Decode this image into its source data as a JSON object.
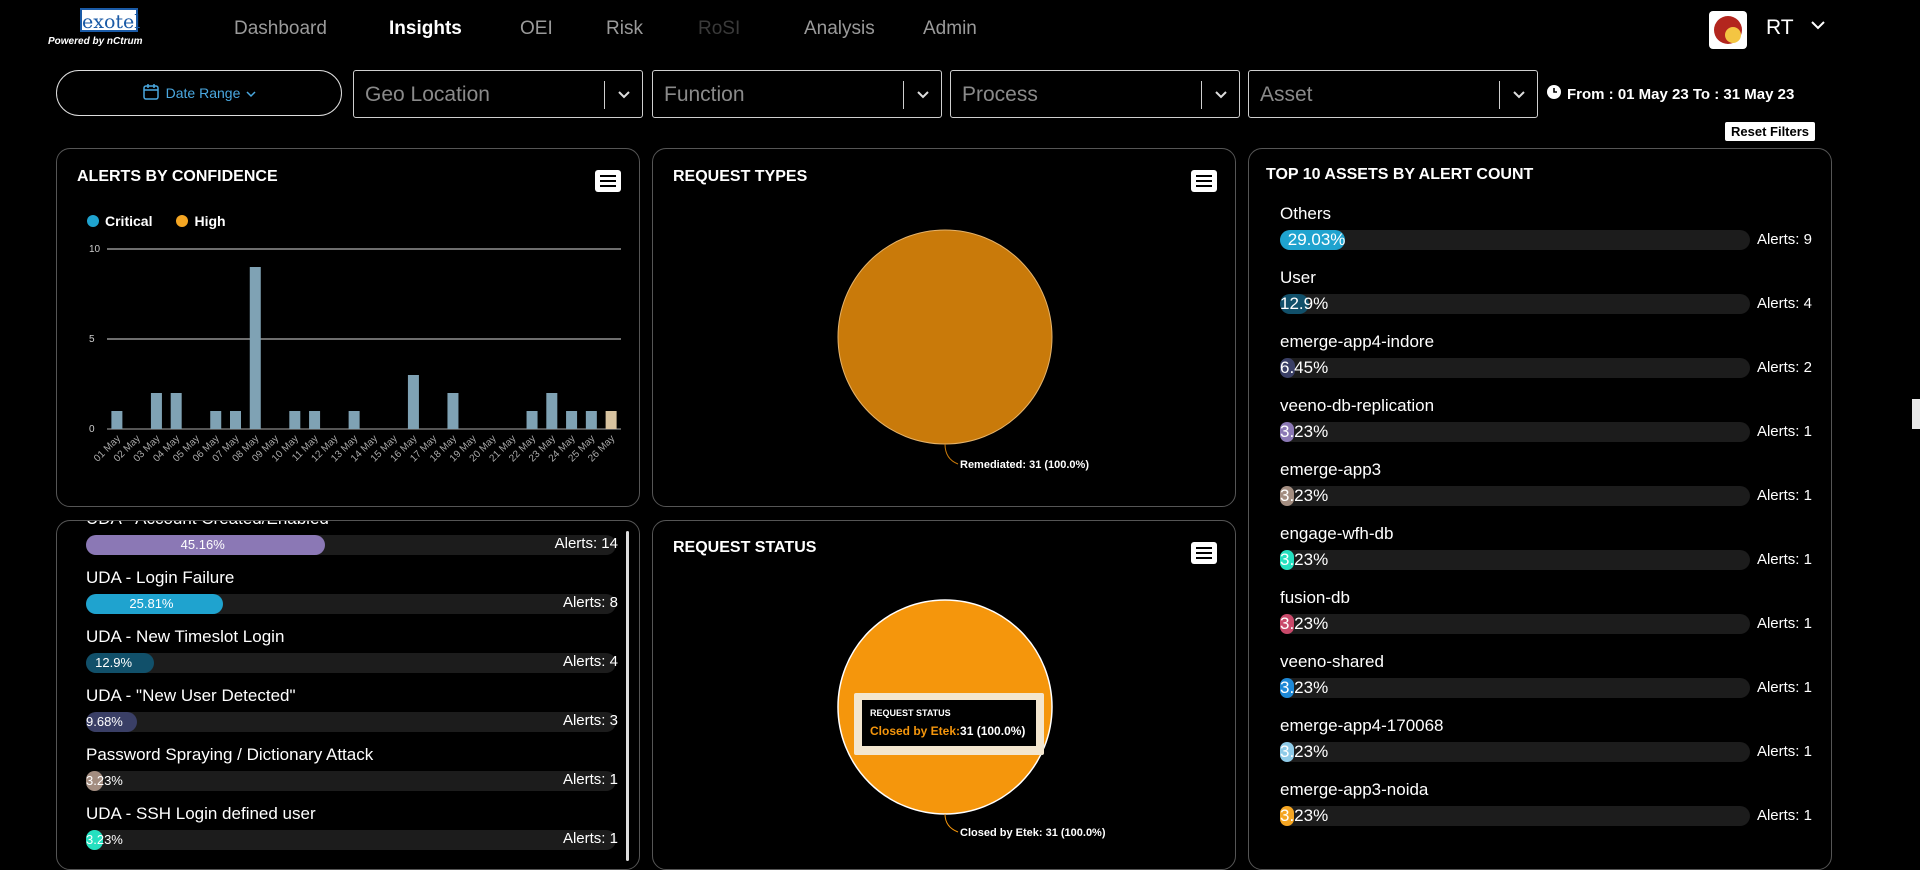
{
  "brand": {
    "name": "exotel",
    "powered_by": "Powered by nCtrum"
  },
  "nav": [
    {
      "label": "Dashboard",
      "state": "normal"
    },
    {
      "label": "Insights",
      "state": "active"
    },
    {
      "label": "OEI",
      "state": "normal"
    },
    {
      "label": "Risk",
      "state": "normal"
    },
    {
      "label": "RoSI",
      "state": "disabled"
    },
    {
      "label": "Analysis",
      "state": "normal"
    },
    {
      "label": "Admin",
      "state": "normal"
    }
  ],
  "user": {
    "initials": "RT"
  },
  "filters": {
    "date_range": "Date Range",
    "geo": "Geo Location",
    "function": "Function",
    "process": "Process",
    "asset": "Asset",
    "period": "From : 01 May 23 To : 31 May 23",
    "reset": "Reset Filters"
  },
  "alerts_by_confidence": {
    "title": "ALERTS BY CONFIDENCE",
    "legend": [
      {
        "label": "Critical",
        "color": "#1fa3cf"
      },
      {
        "label": "High",
        "color": "#f5a623"
      }
    ]
  },
  "chart_data": {
    "type": "bar",
    "title": "ALERTS BY CONFIDENCE",
    "categories": [
      "01 May",
      "02 May",
      "03 May",
      "04 May",
      "05 May",
      "06 May",
      "07 May",
      "08 May",
      "09 May",
      "10 May",
      "11 May",
      "12 May",
      "13 May",
      "14 May",
      "15 May",
      "16 May",
      "17 May",
      "18 May",
      "19 May",
      "20 May",
      "21 May",
      "22 May",
      "23 May",
      "24 May",
      "25 May",
      "26 May"
    ],
    "yticks": [
      0,
      5,
      10
    ],
    "ylim": [
      0,
      10
    ],
    "series": [
      {
        "name": "Critical",
        "values": [
          1,
          0,
          2,
          2,
          0,
          1,
          1,
          9,
          0,
          1,
          1,
          0,
          1,
          0,
          0,
          3,
          0,
          2,
          0,
          0,
          0,
          1,
          2,
          1,
          1,
          0
        ]
      },
      {
        "name": "High",
        "values": [
          0,
          0,
          0,
          0,
          0,
          0,
          0,
          0,
          0,
          0,
          0,
          0,
          0,
          0,
          0,
          0,
          0,
          0,
          0,
          0,
          0,
          0,
          0,
          0,
          0,
          1
        ]
      }
    ]
  },
  "request_types": {
    "title": "REQUEST TYPES",
    "slices": [
      {
        "label": "Remediated: 31 (100.0%)",
        "value": 31,
        "color": "#c97a0a"
      }
    ]
  },
  "request_status": {
    "title": "REQUEST STATUS",
    "slices": [
      {
        "label": "Closed by Etek: 31 (100.0%)",
        "value": 31,
        "color": "#f5960c"
      }
    ],
    "tooltip": {
      "title": "REQUEST STATUS",
      "series": "Closed by Etek:",
      "value": "31 (100.0%)"
    }
  },
  "alert_types": [
    {
      "label": "UDA - Account Created/Enabled",
      "pct": "45.16%",
      "fraction": 0.4516,
      "count": "Alerts: 14",
      "color": "#8b78b5"
    },
    {
      "label": "UDA - Login Failure",
      "pct": "25.81%",
      "fraction": 0.2581,
      "count": "Alerts: 8",
      "color": "#1fa3cf"
    },
    {
      "label": "UDA - New Timeslot Login",
      "pct": "12.9%",
      "fraction": 0.129,
      "count": "Alerts: 4",
      "color": "#11506a"
    },
    {
      "label": "UDA - \"New User Detected\"",
      "pct": "9.68%",
      "fraction": 0.0968,
      "count": "Alerts: 3",
      "color": "#3a3f66"
    },
    {
      "label": "Password Spraying / Dictionary Attack",
      "pct": "3.23%",
      "fraction": 0.0323,
      "count": "Alerts: 1",
      "color": "#a38d80"
    },
    {
      "label": "UDA - SSH Login defined user",
      "pct": "3.23%",
      "fraction": 0.0323,
      "count": "Alerts: 1",
      "color": "#25e0c0"
    }
  ],
  "top_assets": {
    "title": "TOP 10 ASSETS BY ALERT COUNT",
    "items": [
      {
        "label": "Others",
        "pct": "29.03%",
        "fraction": 0.2903,
        "count": "Alerts: 9",
        "color": "#1fa3cf"
      },
      {
        "label": "User",
        "pct": "12.9%",
        "fraction": 0.129,
        "count": "Alerts: 4",
        "color": "#11506a"
      },
      {
        "label": "emerge-app4-indore",
        "pct": "6.45%",
        "fraction": 0.0645,
        "count": "Alerts: 2",
        "color": "#3a3f66"
      },
      {
        "label": "veeno-db-replication",
        "pct": "3.23%",
        "fraction": 0.0323,
        "count": "Alerts: 1",
        "color": "#8b78b5"
      },
      {
        "label": "emerge-app3",
        "pct": "3.23%",
        "fraction": 0.0323,
        "count": "Alerts: 1",
        "color": "#a38d80"
      },
      {
        "label": "engage-wfh-db",
        "pct": "3.23%",
        "fraction": 0.0323,
        "count": "Alerts: 1",
        "color": "#25e0c0"
      },
      {
        "label": "fusion-db",
        "pct": "3.23%",
        "fraction": 0.0323,
        "count": "Alerts: 1",
        "color": "#c9496a"
      },
      {
        "label": "veeno-shared",
        "pct": "3.23%",
        "fraction": 0.0323,
        "count": "Alerts: 1",
        "color": "#1e88d6"
      },
      {
        "label": "emerge-app4-170068",
        "pct": "3.23%",
        "fraction": 0.0323,
        "count": "Alerts: 1",
        "color": "#8ecbe8"
      },
      {
        "label": "emerge-app3-noida",
        "pct": "3.23%",
        "fraction": 0.0323,
        "count": "Alerts: 1",
        "color": "#f5a623"
      }
    ]
  }
}
